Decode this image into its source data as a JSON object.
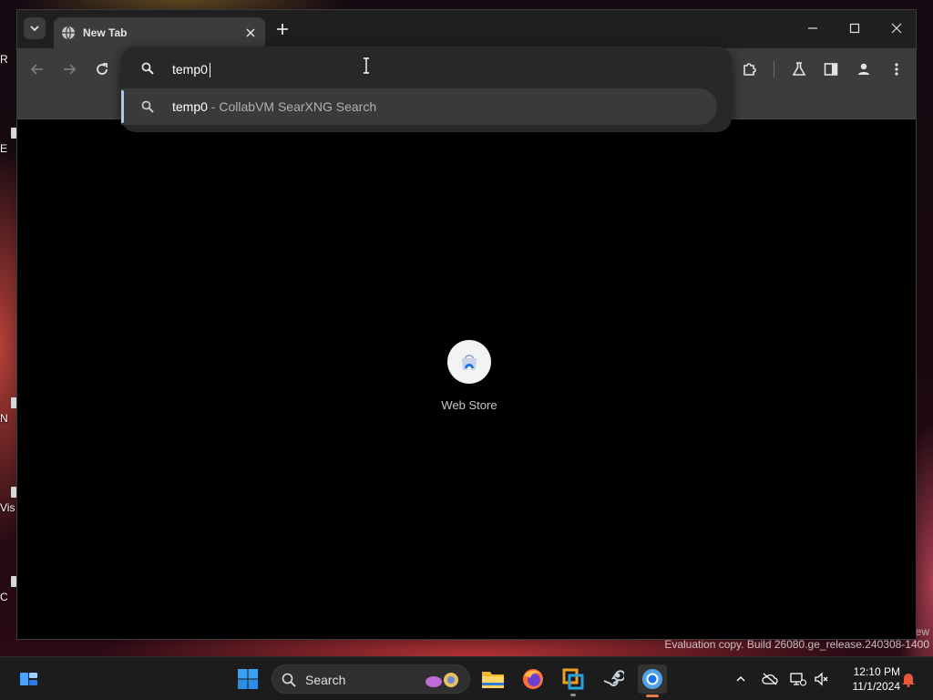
{
  "browser": {
    "tab": {
      "title": "New Tab"
    },
    "omnibox": {
      "value": "temp0",
      "suggestion": {
        "query": "temp0",
        "separator": " - ",
        "provider": "CollabVM SearXNG Search"
      }
    },
    "shortcuts": [
      {
        "label": "Web Store"
      }
    ]
  },
  "taskbar": {
    "search_label": "Search",
    "clock_time": "12:10 PM",
    "clock_date": "11/1/2024"
  },
  "desktop": {
    "icon_fragments": [
      "R",
      "E",
      "N",
      "Vis",
      "C"
    ],
    "edge_text": "ew",
    "watermark": "Evaluation copy. Build 26080.ge_release.240308-1400"
  },
  "icons": {
    "tab": [
      "chevron-down-icon",
      "globe-icon",
      "close-icon",
      "plus-icon"
    ],
    "window": [
      "minimize-icon",
      "maximize-icon",
      "close-icon"
    ],
    "toolbar": [
      "back-arrow-icon",
      "forward-arrow-icon",
      "reload-icon",
      "extensions-icon",
      "labs-flask-icon",
      "side-panel-icon",
      "profile-icon",
      "more-vert-icon"
    ],
    "taskbar": [
      "windows-start-icon",
      "search-icon",
      "file-explorer-icon",
      "firefox-icon",
      "vmware-icon",
      "steam-icon",
      "chrome-icon"
    ],
    "tray": [
      "chevron-up-icon",
      "cloud-offline-icon",
      "network-icon",
      "volume-muted-icon",
      "notification-bell-icon"
    ]
  },
  "colors": {
    "accent": "#a8c7fa",
    "taskbar_active_indicator": "#e67c50",
    "chrome_frame": "#3c3c3c"
  }
}
